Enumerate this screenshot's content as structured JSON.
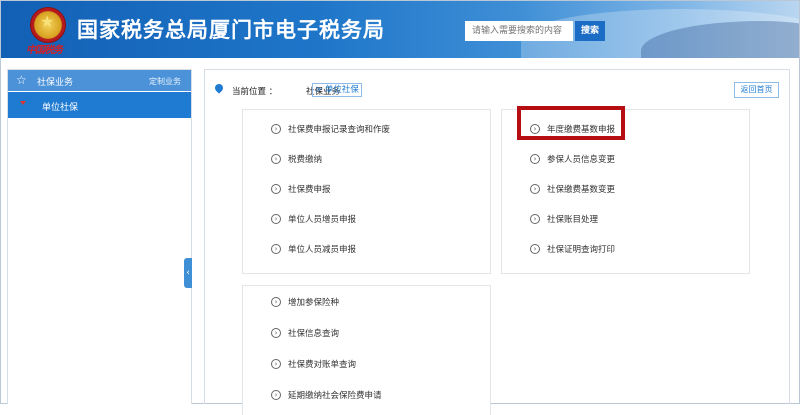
{
  "header": {
    "title": "国家税务总局厦门市电子税务局",
    "seal_text": "中国税务",
    "search_placeholder": "请输入需要搜索的内容",
    "search_button": "搜索"
  },
  "sidebar": {
    "section_title": "社保业务",
    "custom_label": "定制业务",
    "items": [
      {
        "label": "单位社保"
      }
    ],
    "collapse_glyph": "‹"
  },
  "breadcrumb": {
    "label": "当前位置 ：",
    "section": "社保业务",
    "current": "> 单位社保"
  },
  "home_button": "返回首页",
  "panels": {
    "a": [
      "社保费申报记录查询和作废",
      "税费缴纳",
      "社保费申报",
      "单位人员增员申报",
      "单位人员减员申报"
    ],
    "b": [
      "年度缴费基数申报",
      "参保人员信息变更",
      "社保缴费基数变更",
      "社保账目处理",
      "社保证明查询打印"
    ],
    "c": [
      "增加参保险种",
      "社保信息查询",
      "社保费对账单查询",
      "延期缴纳社会保险费申请"
    ]
  },
  "item_icon": "circle-chevron-right-icon",
  "colors": {
    "header_blue": "#1f76c9",
    "sidebar_active": "#1f7ad1",
    "highlight_red": "#b50d12"
  }
}
